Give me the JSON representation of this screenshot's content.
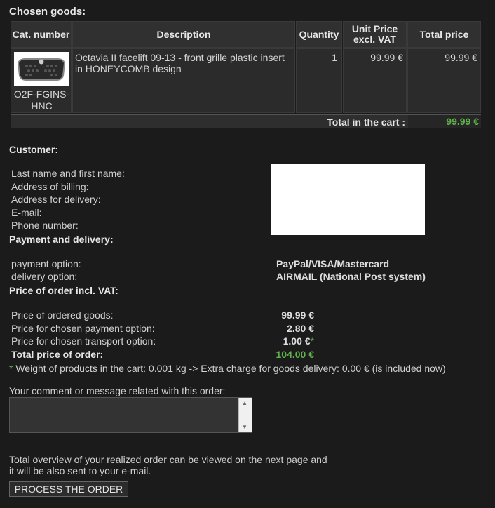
{
  "chosen_goods_title": "Chosen goods:",
  "table": {
    "headers": {
      "cat_number": "Cat. number",
      "description": "Description",
      "quantity": "Quantity",
      "unit_price": "Unit Price excl. VAT",
      "total_price": "Total price"
    },
    "rows": [
      {
        "cat_number": "O2F-FGINS-HNC",
        "description": "Octavia II facelift 09-13 - front grille plastic insert in HONEYCOMB design",
        "quantity": "1",
        "unit_price": "99.99 €",
        "total_price": "99.99 €",
        "image_icon": "grille-thumbnail-icon"
      }
    ],
    "total_label": "Total in the cart :",
    "total_value": "99.99 €"
  },
  "customer": {
    "title": "Customer:",
    "fields": [
      "Last name and first name:",
      "Address of billing:",
      "Address for delivery:",
      "E-mail:",
      "Phone number:"
    ]
  },
  "payment": {
    "title": "Payment and delivery:",
    "payment_label": "payment option:",
    "payment_value": "PayPal/VISA/Mastercard",
    "delivery_label": "delivery option:",
    "delivery_value": "AIRMAIL (National Post system)"
  },
  "price": {
    "title": "Price of order incl. VAT:",
    "ordered_label": "Price of ordered goods:",
    "ordered_value": "99.99 €",
    "payment_label": "Price for chosen payment option:",
    "payment_value": "2.80 €",
    "transport_label": "Price for chosen transport option:",
    "transport_value": "1.00 €",
    "transport_star": "*",
    "total_label": "Total price of order:",
    "total_value": "104.00 €"
  },
  "weight_note": {
    "star": "*",
    "text": "Weight of products in the cart: 0.001 kg -> Extra charge for goods delivery: 0.00 € (is included now)"
  },
  "comment": {
    "label": "Your comment or message related with this order:",
    "value": ""
  },
  "overview_text_1": "Total overview of your realized order can be viewed on the next page and",
  "overview_text_2": "it will be also sent to your e-mail.",
  "process_button": "PROCESS THE ORDER",
  "colors": {
    "background": "#1b1b1b",
    "accent_green": "#5fb24a"
  }
}
